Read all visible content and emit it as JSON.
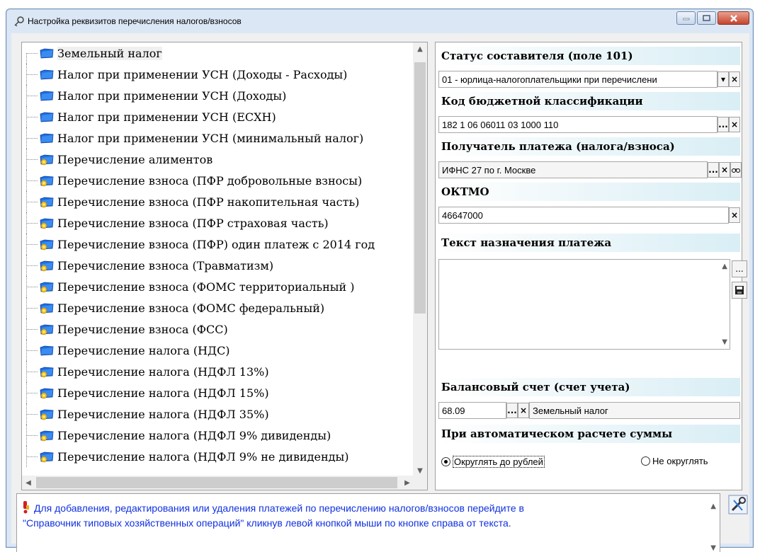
{
  "window": {
    "title": "Настройка реквизитов перечисления налогов/взносов",
    "buttons": [
      "minimize-icon",
      "maximize-icon",
      "close-icon"
    ]
  },
  "tree": {
    "items": [
      {
        "label": "Земельный налог",
        "icon": "folder-blue-icon",
        "selected": true
      },
      {
        "label": "Налог при применении УСН (Доходы - Расходы)",
        "icon": "folder-blue-icon"
      },
      {
        "label": "Налог при применении УСН (Доходы)",
        "icon": "folder-blue-icon"
      },
      {
        "label": "Налог при применении УСН (ЕСХН)",
        "icon": "folder-blue-icon"
      },
      {
        "label": "Налог при применении УСН (минимальный налог)",
        "icon": "folder-blue-icon"
      },
      {
        "label": "Перечисление алиментов",
        "icon": "folder-blue-yellow-icon"
      },
      {
        "label": "Перечисление взноса (ПФР добровольные взносы)",
        "icon": "folder-blue-yellow-icon"
      },
      {
        "label": "Перечисление взноса (ПФР накопительная часть)",
        "icon": "folder-blue-yellow-icon"
      },
      {
        "label": "Перечисление взноса (ПФР страховая часть)",
        "icon": "folder-blue-yellow-icon"
      },
      {
        "label": "Перечисление взноса (ПФР) один платеж с 2014 год",
        "icon": "folder-blue-yellow-icon"
      },
      {
        "label": "Перечисление взноса (Травматизм)",
        "icon": "folder-blue-yellow-icon"
      },
      {
        "label": "Перечисление взноса (ФОМС территориальный )",
        "icon": "folder-blue-yellow-icon"
      },
      {
        "label": "Перечисление взноса (ФОМС федеральный)",
        "icon": "folder-blue-yellow-icon"
      },
      {
        "label": "Перечисление взноса (ФСС)",
        "icon": "folder-blue-yellow-icon"
      },
      {
        "label": "Перечисление налога (НДС)",
        "icon": "folder-blue-icon"
      },
      {
        "label": "Перечисление налога (НДФЛ 13%)",
        "icon": "folder-blue-yellow-icon"
      },
      {
        "label": "Перечисление налога (НДФЛ 15%)",
        "icon": "folder-blue-yellow-icon"
      },
      {
        "label": "Перечисление налога (НДФЛ 35%)",
        "icon": "folder-blue-yellow-icon"
      },
      {
        "label": "Перечисление налога (НДФЛ 9% дивиденды)",
        "icon": "folder-blue-yellow-icon"
      },
      {
        "label": "Перечисление налога (НДФЛ 9% не дивиденды)",
        "icon": "folder-blue-yellow-icon"
      }
    ]
  },
  "panel": {
    "status_label": "Статус составителя (поле 101)",
    "status_value": "01 - юрлица-налогоплательщики при перечислени",
    "kbk_label": "Код бюджетной классификации",
    "kbk_value": "182 1 06 06011 03 1000 110",
    "recipient_label": "Получатель платежа (налога/взноса)",
    "recipient_value": "ИФНС 27 по г. Москве",
    "oktmo_label": "ОКТМО",
    "oktmo_value": "46647000",
    "purpose_label": "Текст назначения платежа",
    "purpose_value": "",
    "account_label": "Балансовый счет (счет учета)",
    "account_value": "68.09",
    "account_name": "Земельный налог",
    "auto_label": "При автоматическом расчете суммы",
    "round_option": "Округлять до рублей",
    "noround_option": "Не округлять",
    "round_selected": true,
    "dropdown_glyph": "▾",
    "clear_glyph": "×",
    "ellipsis_glyph": "..."
  },
  "info": {
    "line1": "Для добавления, редактирования или удаления платежей по перечислению налогов/взносов перейдите в",
    "line2": "\"Справочник типовых хозяйственных операций\" кликнув левой кнопкой мыши по кнопке справа от текста.",
    "color": "#1030e0"
  }
}
